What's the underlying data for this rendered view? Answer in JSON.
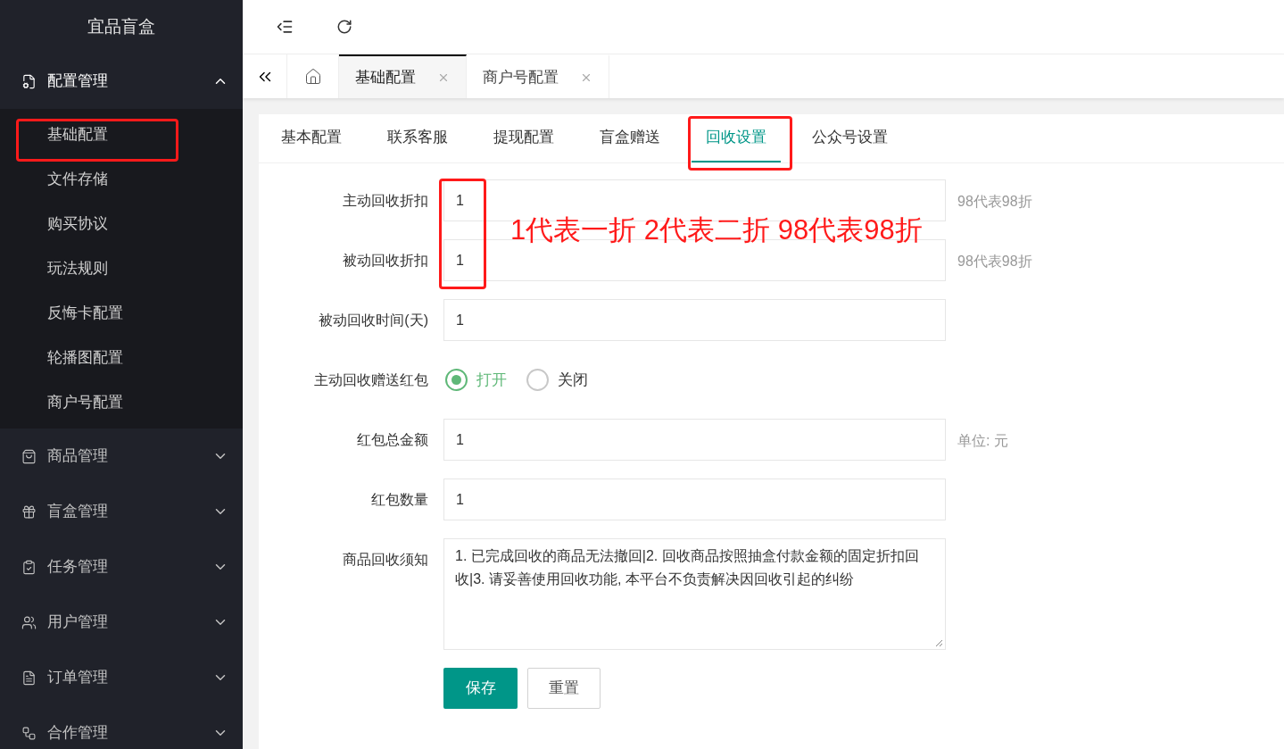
{
  "sidebar": {
    "logo": "宜品盲盒",
    "groups": [
      {
        "label": "配置管理",
        "expanded": true,
        "children": [
          "基础配置",
          "文件存储",
          "购买协议",
          "玩法规则",
          "反悔卡配置",
          "轮播图配置",
          "商户号配置"
        ]
      },
      {
        "label": "商品管理",
        "expanded": false
      },
      {
        "label": "盲盒管理",
        "expanded": false
      },
      {
        "label": "任务管理",
        "expanded": false
      },
      {
        "label": "用户管理",
        "expanded": false
      },
      {
        "label": "订单管理",
        "expanded": false
      },
      {
        "label": "合作管理",
        "expanded": false
      }
    ]
  },
  "page_tabs": [
    {
      "label": "基础配置",
      "selected": true
    },
    {
      "label": "商户号配置",
      "selected": false
    }
  ],
  "section_tabs": [
    {
      "label": "基本配置",
      "selected": false
    },
    {
      "label": "联系客服",
      "selected": false
    },
    {
      "label": "提现配置",
      "selected": false
    },
    {
      "label": "盲盒赠送",
      "selected": false
    },
    {
      "label": "回收设置",
      "selected": true
    },
    {
      "label": "公众号设置",
      "selected": false
    }
  ],
  "form": [
    {
      "kind": "input",
      "label": "主动回收折扣",
      "value": "1",
      "hint": "98代表98折"
    },
    {
      "kind": "input",
      "label": "被动回收折扣",
      "value": "1",
      "hint": "98代表98折"
    },
    {
      "kind": "input",
      "label": "被动回收时间(天)",
      "value": "1"
    },
    {
      "kind": "radio",
      "label": "主动回收赠送红包",
      "options": [
        {
          "label": "打开",
          "selected": true
        },
        {
          "label": "关闭",
          "selected": false
        }
      ]
    },
    {
      "kind": "input",
      "label": "红包总金额",
      "value": "1",
      "hint": "单位: 元"
    },
    {
      "kind": "input",
      "label": "红包数量",
      "value": "1"
    },
    {
      "kind": "textarea",
      "label": "商品回收须知",
      "value": "1. 已完成回收的商品无法撤回|2. 回收商品按照抽盒付款金额的固定折扣回收|3. 请妥善使用回收功能, 本平台不负责解决因回收引起的纠纷"
    }
  ],
  "buttons": {
    "save": "保存",
    "reset": "重置"
  },
  "annotation": "1代表一折 2代表二折 98代表98折"
}
